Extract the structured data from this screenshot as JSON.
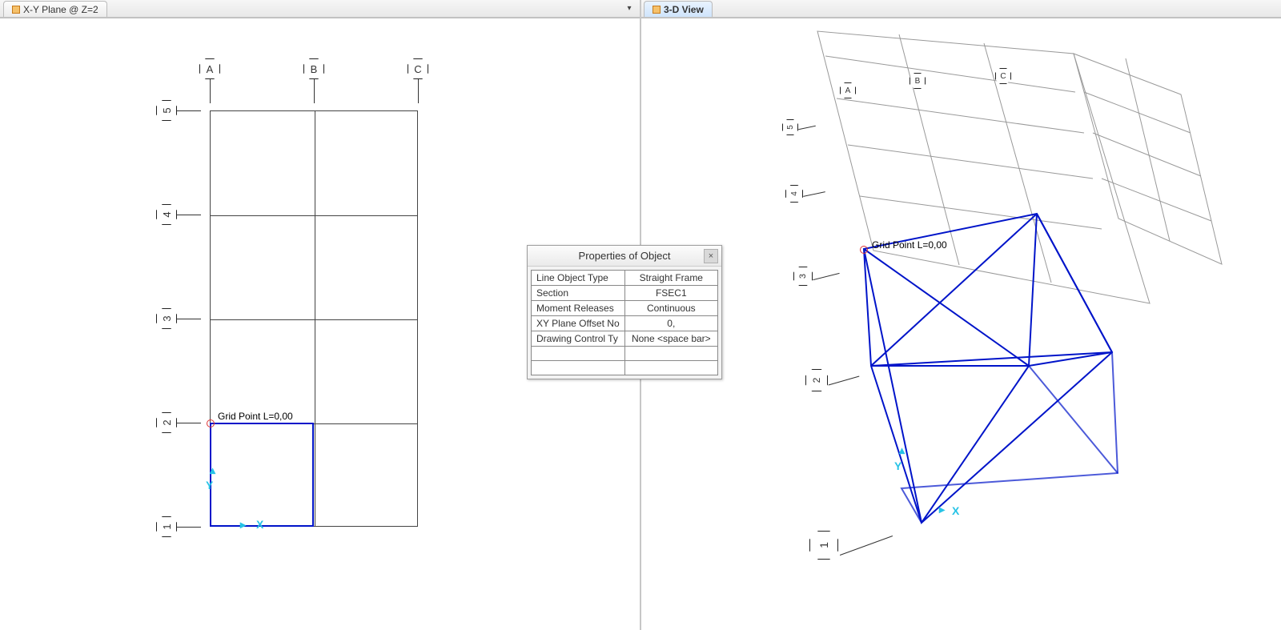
{
  "tabs": {
    "left": {
      "label": "X-Y Plane @ Z=2",
      "active": false
    },
    "right": {
      "label": "3-D View",
      "active": true
    }
  },
  "left_view": {
    "cols": [
      "A",
      "B",
      "C"
    ],
    "rows": [
      "1",
      "2",
      "3",
      "4",
      "5"
    ],
    "point_label": "Grid Point  L=0,00",
    "axis_y": "Y",
    "axis_x": "X"
  },
  "right_view": {
    "cols": [
      "A",
      "B",
      "C"
    ],
    "rows": [
      "1",
      "2",
      "3",
      "4",
      "5"
    ],
    "point_label": "Grid Point  L=0,00",
    "axis_y": "Y",
    "axis_x": "X"
  },
  "properties": {
    "title": "Properties of Object",
    "rows": [
      {
        "k": "Line Object Type",
        "v": "Straight Frame"
      },
      {
        "k": "Section",
        "v": "FSEC1"
      },
      {
        "k": "Moment Releases",
        "v": "Continuous"
      },
      {
        "k": "XY Plane Offset No",
        "v": "0,"
      },
      {
        "k": "Drawing Control Ty",
        "v": "None  <space bar>"
      },
      {
        "k": "",
        "v": ""
      },
      {
        "k": "",
        "v": ""
      }
    ]
  }
}
